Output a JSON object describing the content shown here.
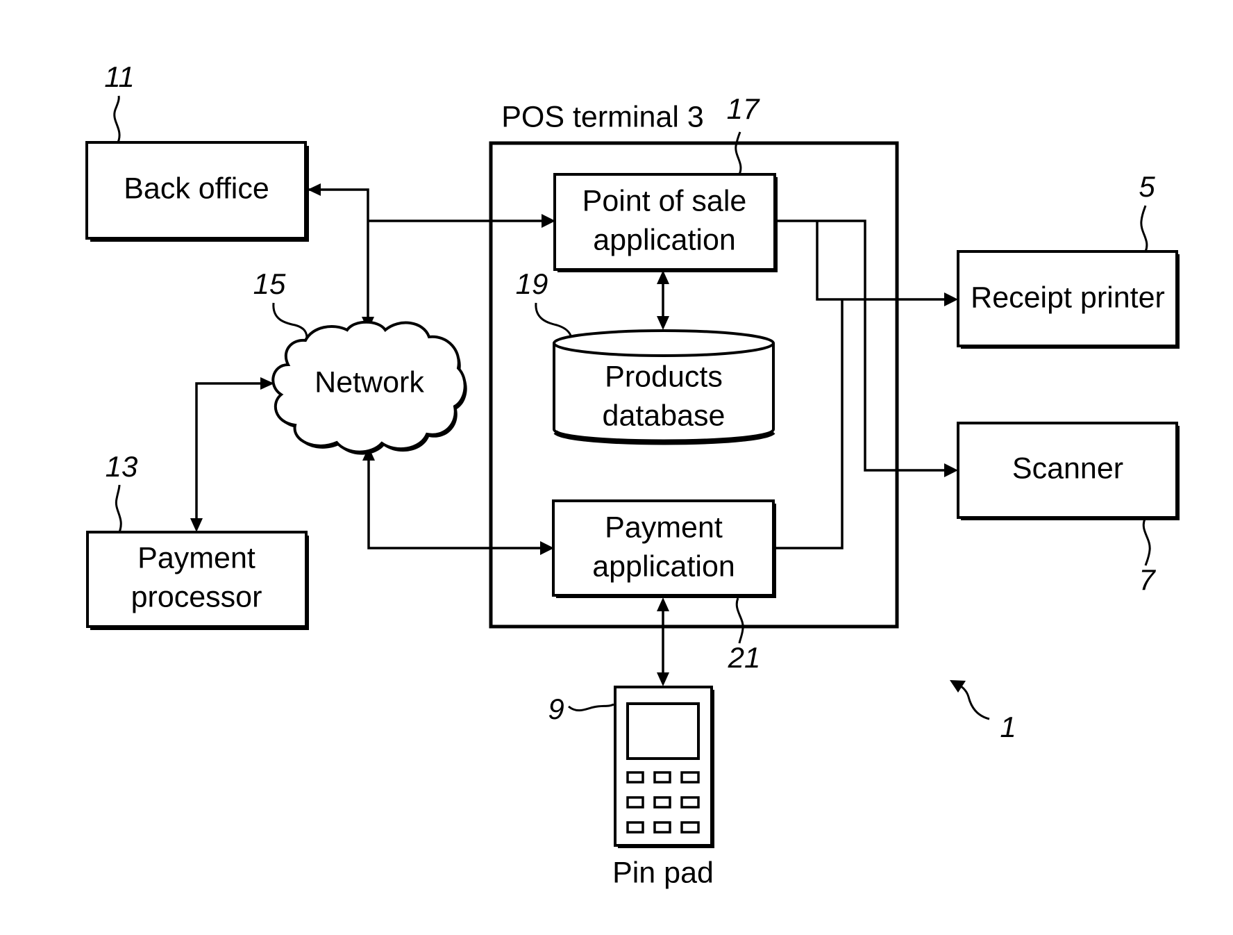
{
  "diagram": {
    "figure_ref": "1",
    "nodes": {
      "back_office": {
        "label": "Back office",
        "ref": "11"
      },
      "payment_processor": {
        "label_lines": [
          "Payment",
          "processor"
        ],
        "ref": "13"
      },
      "network": {
        "label": "Network",
        "ref": "15"
      },
      "pos_terminal": {
        "label": "POS terminal 3"
      },
      "pos_application": {
        "label_lines": [
          "Point of sale",
          "application"
        ],
        "ref": "17"
      },
      "products_database": {
        "label_lines": [
          "Products",
          "database"
        ],
        "ref": "19"
      },
      "payment_application": {
        "label_lines": [
          "Payment",
          "application"
        ],
        "ref": "21"
      },
      "receipt_printer": {
        "label": "Receipt printer",
        "ref": "5"
      },
      "scanner": {
        "label": "Scanner",
        "ref": "7"
      },
      "pin_pad": {
        "label": "Pin pad",
        "ref": "9"
      }
    },
    "connections": [
      {
        "from": "network",
        "to": "back_office",
        "direction": "bidirectional"
      },
      {
        "from": "network",
        "to": "pos_application",
        "direction": "to"
      },
      {
        "from": "payment_processor",
        "to": "network",
        "direction": "bidirectional"
      },
      {
        "from": "network",
        "to": "payment_application",
        "direction": "bidirectional"
      },
      {
        "from": "pos_application",
        "to": "products_database",
        "direction": "bidirectional"
      },
      {
        "from": "pos_application",
        "to": "receipt_printer",
        "direction": "to"
      },
      {
        "from": "pos_application",
        "to": "scanner",
        "direction": "to"
      },
      {
        "from": "payment_application",
        "to": "receipt_printer",
        "direction": "to"
      },
      {
        "from": "payment_application",
        "to": "pin_pad",
        "direction": "bidirectional"
      }
    ]
  }
}
